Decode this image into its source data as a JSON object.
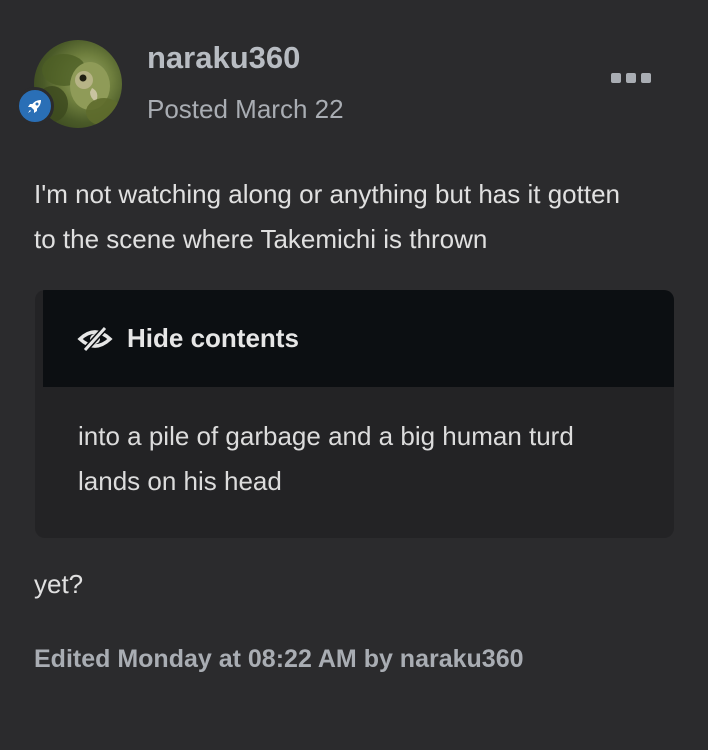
{
  "post": {
    "author": "naraku360",
    "posted": "Posted March 22",
    "avatar_icon": "parrot-avatar",
    "rank_icon": "rocket-icon",
    "more_icon": "ellipsis-icon",
    "body_lines": [
      "I'm not watching along or anything but has it gotten",
      "to the scene where Takemichi is thrown"
    ],
    "spoiler": {
      "toggle_label": "Hide contents",
      "toggle_icon": "eye-slash-icon",
      "content_lines": [
        "into a pile of garbage and a big human turd",
        "lands on his head"
      ]
    },
    "after_text": "yet?",
    "edited": "Edited Monday at 08:22 AM by naraku360"
  },
  "colors": {
    "background": "#2b2b2d",
    "spoiler_header": "#0c0f12",
    "spoiler_body": "#232325",
    "rank_badge": "#2a6fb6"
  }
}
